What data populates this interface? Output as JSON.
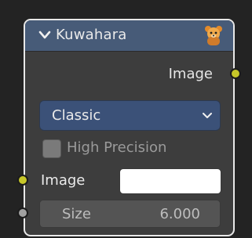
{
  "node": {
    "title": "Kuwahara",
    "header_color": "#475b78",
    "collapse_icon": "chevron-down-icon",
    "header_icon": "bear-icon"
  },
  "outputs": [
    {
      "label": "Image",
      "socket_color": "#c7c729"
    }
  ],
  "variation_select": {
    "selected": "Classic",
    "icon": "chevron-down-icon"
  },
  "high_precision": {
    "label": "High Precision",
    "checked": false
  },
  "inputs": {
    "image": {
      "label": "Image",
      "value_color": "#ffffff",
      "socket_color": "#c7c729"
    },
    "size": {
      "label": "Size",
      "value": "6.000",
      "socket_color": "#a1a1a1"
    }
  }
}
